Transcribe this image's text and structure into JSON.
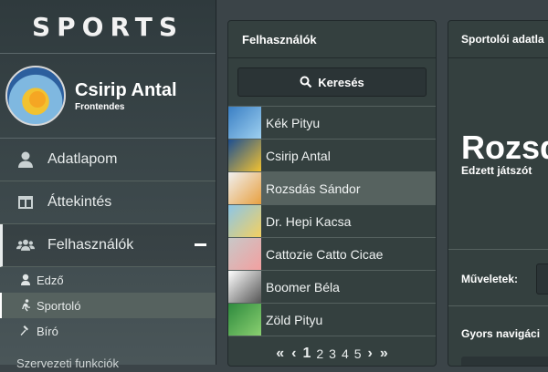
{
  "brand": {
    "title": "SPORTS"
  },
  "profile": {
    "name": "Csirip Antal",
    "role": "Frontendes"
  },
  "nav": {
    "profile_label": "Adatlapom",
    "overview_label": "Áttekintés",
    "users_label": "Felhasználók",
    "sub": [
      "Edző",
      "Sportoló",
      "Bíró"
    ],
    "cut_label": "Szervezeti funkciók"
  },
  "users_panel": {
    "title": "Felhasználók",
    "search_label": "Keresés",
    "users": [
      "Kék Pityu",
      "Csirip Antal",
      "Rozsdás Sándor",
      "Dr. Hepi Kacsa",
      "Cattozie Catto Cicae",
      "Boomer Béla",
      "Zöld Pityu"
    ],
    "selected_user": "Rozsdás Sándor",
    "pager": {
      "pages": [
        "1",
        "2",
        "3",
        "4",
        "5"
      ],
      "current": "1",
      "first": "«",
      "prev": "‹",
      "next": "›",
      "last": "»"
    }
  },
  "detail_panel": {
    "title": "Sportolói adatla",
    "name": "Rozsdá",
    "subtitle": "Edzett játszót",
    "actions_label": "Műveletek:",
    "quick_nav_label": "Gyors navigáci"
  },
  "icons": [
    "user-icon",
    "columns-icon",
    "users-icon",
    "minus-icon",
    "whistle-icon",
    "runner-icon",
    "gavel-icon",
    "search-icon",
    "chevron-double-left-icon",
    "chevron-left-icon",
    "chevron-right-icon",
    "chevron-double-right-icon"
  ],
  "colors": {
    "sidebar": "#3e4a4d",
    "panel": "#34403f",
    "selected": "#56625f",
    "text": "#ffffff"
  }
}
